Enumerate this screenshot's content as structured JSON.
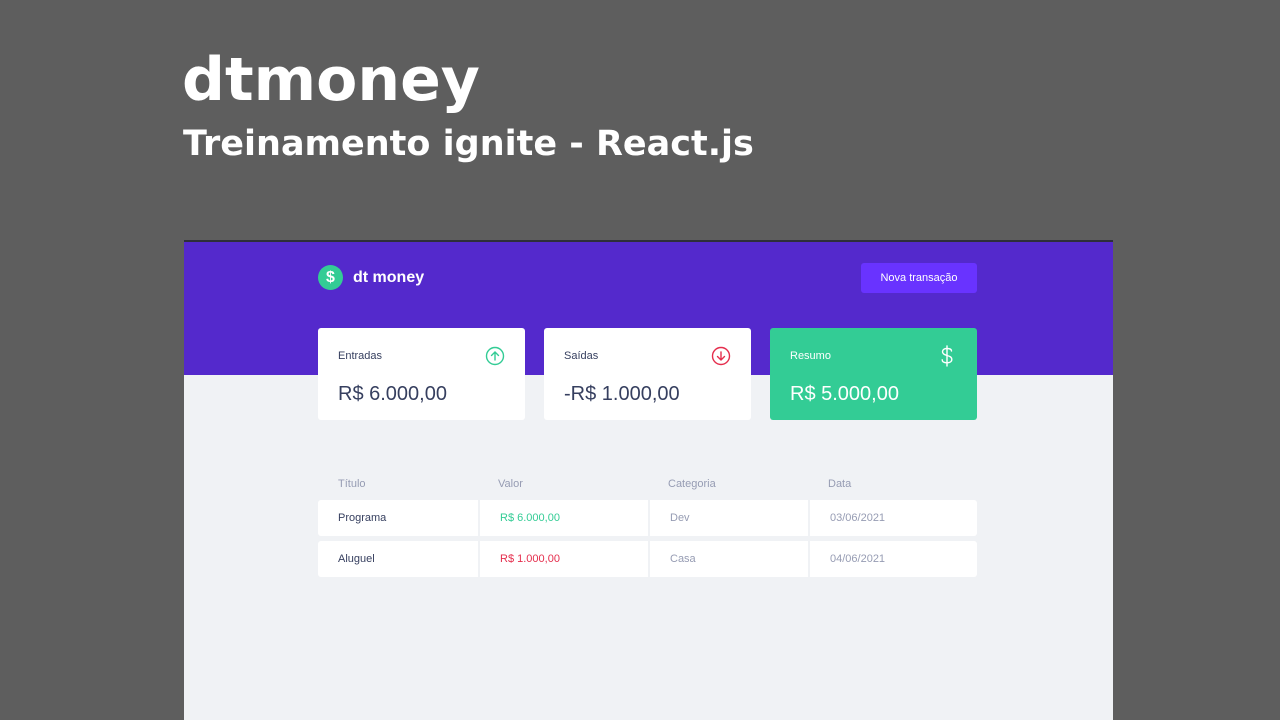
{
  "hero": {
    "title": "dtmoney",
    "subtitle": "Treinamento ignite - React.js"
  },
  "app": {
    "logo_symbol": "$",
    "logo_text": "dt money",
    "new_transaction_label": "Nova transação",
    "summary": {
      "income": {
        "label": "Entradas",
        "value": "R$ 6.000,00",
        "icon": "arrow-circle-up-icon",
        "color": "#33cc95"
      },
      "outcome": {
        "label": "Saídas",
        "value": "-R$ 1.000,00",
        "icon": "arrow-circle-down-icon",
        "color": "#e52e4d"
      },
      "total": {
        "label": "Resumo",
        "value": "R$ 5.000,00",
        "icon": "dollar-icon",
        "color": "#33cc95"
      }
    },
    "table": {
      "headers": [
        "Título",
        "Valor",
        "Categoria",
        "Data"
      ],
      "rows": [
        {
          "title": "Programa",
          "amount": "R$ 6.000,00",
          "type": "deposit",
          "category": "Dev",
          "date": "03/06/2021"
        },
        {
          "title": "Aluguel",
          "amount": "R$ 1.000,00",
          "type": "withdraw",
          "category": "Casa",
          "date": "04/06/2021"
        }
      ]
    },
    "colors": {
      "header_bg": "#5429cc",
      "button_bg": "#6933ff",
      "page_bg": "#f0f2f5",
      "text": "#363f5f",
      "muted": "#969cb3"
    }
  }
}
